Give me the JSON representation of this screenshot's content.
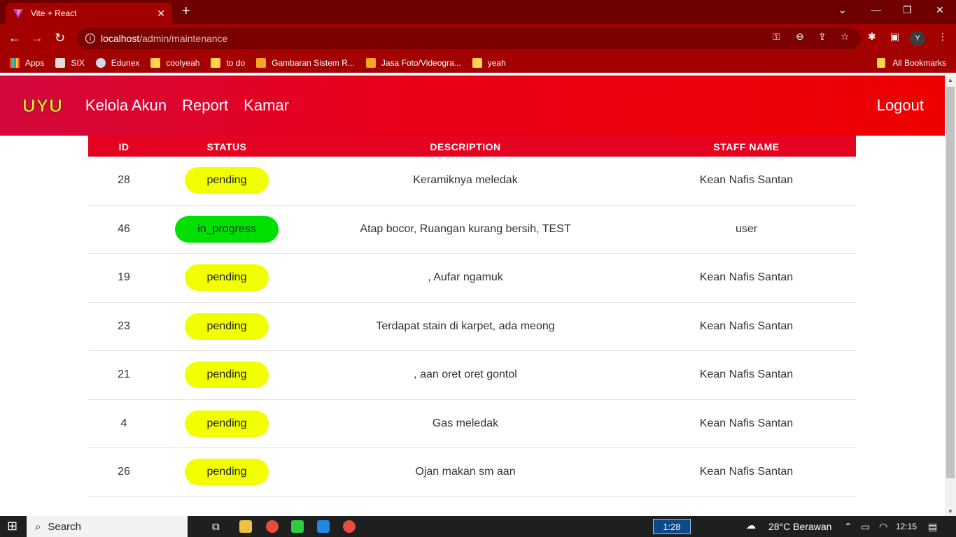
{
  "browser": {
    "tab_title": "Vite + React",
    "tab_close": "✕",
    "new_tab": "+",
    "url_host": "localhost",
    "url_path": "/admin/maintenance",
    "profile_initial": "Y",
    "bookmarks": [
      {
        "label": "Apps",
        "icon": "apps-grid-icon"
      },
      {
        "label": "SIX",
        "icon": "six-icon"
      },
      {
        "label": "Edunex",
        "icon": "edunex-icon"
      },
      {
        "label": "coolyeah",
        "icon": "folder-icon"
      },
      {
        "label": "to do",
        "icon": "folder-icon"
      },
      {
        "label": "Gambaran Sistem R...",
        "icon": "site-icon"
      },
      {
        "label": "Jasa Foto/Videogra...",
        "icon": "site-icon"
      },
      {
        "label": "yeah",
        "icon": "folder-icon"
      }
    ],
    "all_bookmarks": "All Bookmarks"
  },
  "app": {
    "logo": "UYU",
    "nav": [
      "Kelola Akun",
      "Report",
      "Kamar"
    ],
    "logout": "Logout"
  },
  "table": {
    "headers": {
      "id": "ID",
      "status": "STATUS",
      "description": "DESCRIPTION",
      "staff": "STAFF NAME"
    },
    "rows": [
      {
        "id": "28",
        "status": "pending",
        "description": "Keramiknya meledak",
        "staff": "Kean Nafis Santan"
      },
      {
        "id": "46",
        "status": "in_progress",
        "description": "Atap bocor, Ruangan kurang bersih, TEST",
        "staff": "user"
      },
      {
        "id": "19",
        "status": "pending",
        "description": ", Aufar ngamuk",
        "staff": "Kean Nafis Santan"
      },
      {
        "id": "23",
        "status": "pending",
        "description": "Terdapat stain di karpet, ada meong",
        "staff": "Kean Nafis Santan"
      },
      {
        "id": "21",
        "status": "pending",
        "description": ", aan oret oret gontol",
        "staff": "Kean Nafis Santan"
      },
      {
        "id": "4",
        "status": "pending",
        "description": "Gas meledak",
        "staff": "Kean Nafis Santan"
      },
      {
        "id": "26",
        "status": "pending",
        "description": "Ojan makan sm aan",
        "staff": "Kean Nafis Santan"
      }
    ]
  },
  "taskbar": {
    "search": "Search",
    "clock_box": "1:28",
    "weather": "28°C  Berawan",
    "time": "12:15"
  },
  "colors": {
    "tabbar": "#6f0000",
    "toolbar": "#a30000",
    "header_red": "#e40320",
    "pending": "#f2ff00",
    "in_progress": "#00e000"
  }
}
